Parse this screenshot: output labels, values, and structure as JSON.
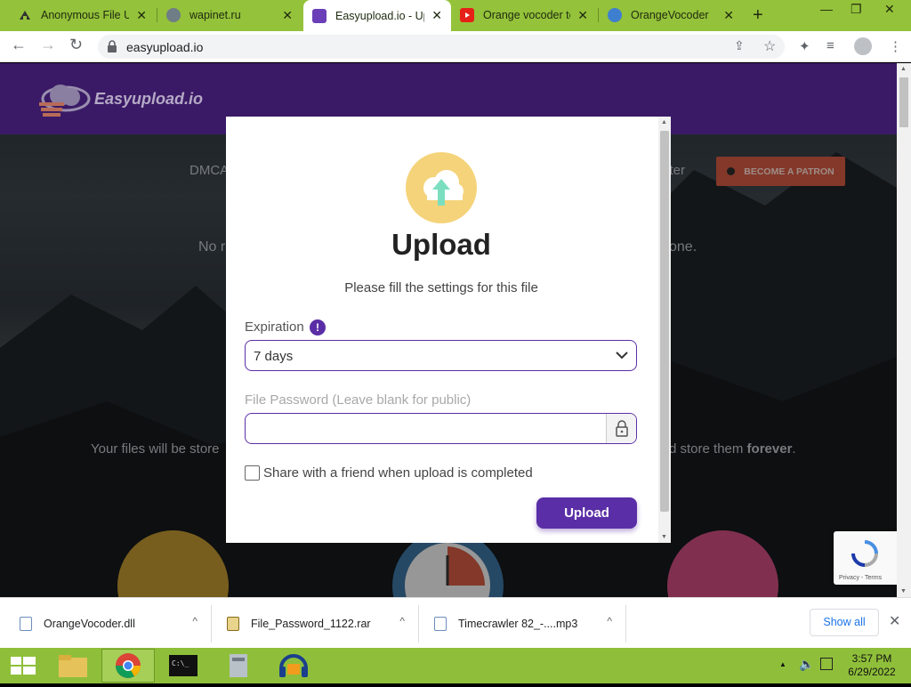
{
  "browser": {
    "tabs": [
      {
        "title": "Anonymous File Up",
        "favicon": "anon-icon",
        "active": false
      },
      {
        "title": "wapinet.ru",
        "favicon": "globe-icon",
        "active": false
      },
      {
        "title": "Easyupload.io - Up",
        "favicon": "easyupload-icon",
        "active": true
      },
      {
        "title": "Orange vocoder te",
        "favicon": "youtube-icon",
        "active": false
      },
      {
        "title": "OrangeVocoder",
        "favicon": "orange-icon",
        "active": false
      }
    ],
    "close_glyph": "✕",
    "new_tab_glyph": "+",
    "url": "easyupload.io"
  },
  "site": {
    "logo_text": "Easyupload.io",
    "nav_partial_left": "DMCA",
    "nav_partial_right": "ster",
    "patron_label": "BECOME A PATRON",
    "hero_partial_left": "No r",
    "hero_partial_right": "one.",
    "store_partial_left": "Your files will be store",
    "store_partial_right": "d store them ",
    "store_bold": "forever",
    "store_end": "."
  },
  "modal": {
    "title": "Upload",
    "subtitle": "Please fill the settings for this file",
    "expiration_label": "Expiration",
    "info_glyph": "!",
    "expiration_value": "7 days",
    "password_label": "File Password (Leave blank for public)",
    "password_value": "",
    "share_label": "Share with a friend when upload is completed",
    "share_checked": false,
    "upload_button": "Upload"
  },
  "recaptcha": {
    "text": "Privacy - Terms"
  },
  "downloads": {
    "items": [
      {
        "name": "OrangeVocoder.dll"
      },
      {
        "name": "File_Password_1122.rar"
      },
      {
        "name": "Timecrawler 82_-....mp3"
      }
    ],
    "show_all": "Show all"
  },
  "taskbar": {
    "time": "3:57 PM",
    "date": "6/29/2022"
  },
  "colors": {
    "accent": "#5a2ea6",
    "header": "#3a1a66",
    "tab_strip": "#94c23a",
    "taskbar": "#8fbf3a"
  }
}
